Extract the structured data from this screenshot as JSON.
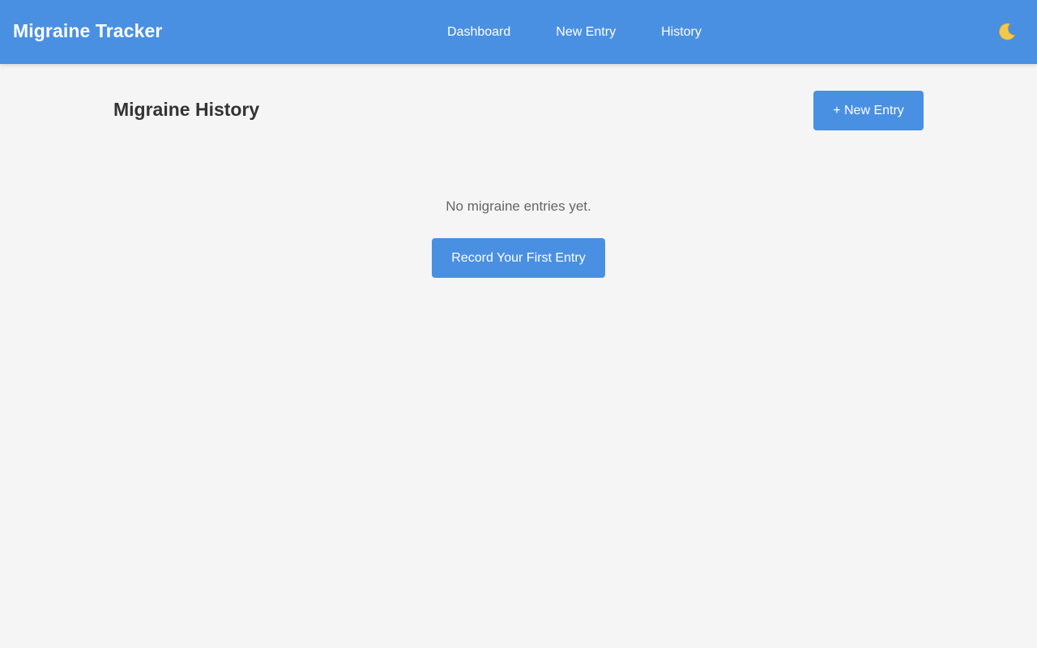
{
  "app": {
    "title": "Migraine Tracker"
  },
  "nav": {
    "items": [
      {
        "label": "Dashboard"
      },
      {
        "label": "New Entry"
      },
      {
        "label": "History"
      }
    ],
    "theme_toggle_icon": "moon-icon"
  },
  "main": {
    "title": "Migraine History",
    "new_entry_button": "+ New Entry",
    "empty_message": "No migraine entries yet.",
    "first_entry_button": "Record Your First Entry"
  },
  "colors": {
    "primary": "#4a90e2",
    "background": "#f5f5f5",
    "heading": "#333333",
    "muted_text": "#666666",
    "moon": "#f2c94c"
  }
}
